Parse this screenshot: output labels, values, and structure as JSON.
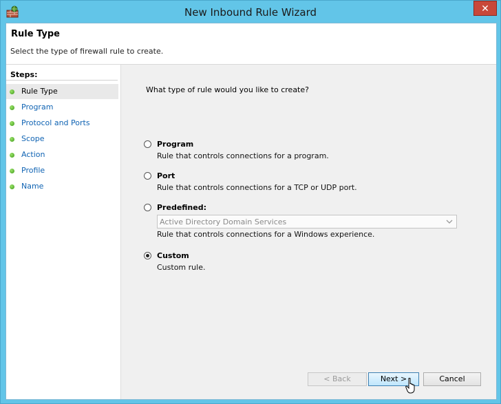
{
  "window": {
    "title": "New Inbound Rule Wizard",
    "close_label": "✕"
  },
  "header": {
    "title": "Rule Type",
    "subtitle": "Select the type of firewall rule to create."
  },
  "steps": {
    "label": "Steps:",
    "items": [
      {
        "label": "Rule Type",
        "current": true
      },
      {
        "label": "Program",
        "current": false
      },
      {
        "label": "Protocol and Ports",
        "current": false
      },
      {
        "label": "Scope",
        "current": false
      },
      {
        "label": "Action",
        "current": false
      },
      {
        "label": "Profile",
        "current": false
      },
      {
        "label": "Name",
        "current": false
      }
    ]
  },
  "main": {
    "question": "What type of rule would you like to create?",
    "options": [
      {
        "label": "Program",
        "description": "Rule that controls connections for a program.",
        "selected": false
      },
      {
        "label": "Port",
        "description": "Rule that controls connections for a TCP or UDP port.",
        "selected": false
      },
      {
        "label": "Predefined:",
        "dropdown_value": "Active Directory Domain Services",
        "description": "Rule that controls connections for a Windows experience.",
        "selected": false
      },
      {
        "label": "Custom",
        "description": "Custom rule.",
        "selected": true
      }
    ]
  },
  "buttons": {
    "back": "< Back",
    "next": "Next >",
    "cancel": "Cancel"
  },
  "colors": {
    "window_frame": "#62c5e8",
    "link_blue": "#0f63b3",
    "step_bullet": "#3d9a19"
  }
}
